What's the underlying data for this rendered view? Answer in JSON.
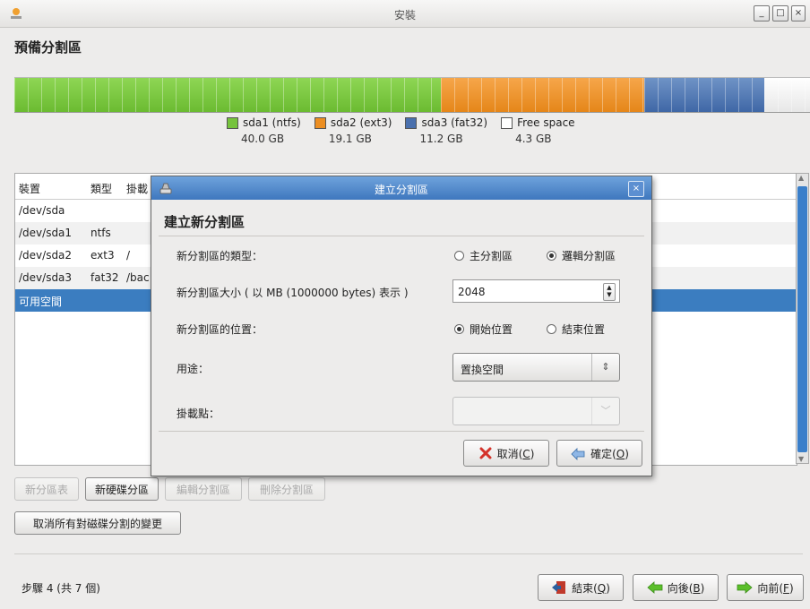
{
  "window": {
    "title": "安裝"
  },
  "page_title": "預備分割區",
  "partition_bar": {
    "segments": [
      {
        "name": "sda1 (ntfs)",
        "size": "40.0 GB",
        "type": "ntfs",
        "color": "#76c33d",
        "fraction": 0.5455
      },
      {
        "name": "sda2 (ext3)",
        "size": "19.1 GB",
        "type": "ext3",
        "color": "#ec8e22",
        "fraction": 0.2605
      },
      {
        "name": "sda3 (fat32)",
        "size": "11.2 GB",
        "type": "fat32",
        "color": "#4a70ad",
        "fraction": 0.1528
      },
      {
        "name": "Free space",
        "size": "4.3 GB",
        "type": "free",
        "color": "#ffffff",
        "fraction": 0.0587
      }
    ]
  },
  "table": {
    "headers": [
      "裝置",
      "類型",
      "掛載"
    ],
    "rows": [
      {
        "device": "/dev/sda",
        "type": "",
        "mount": ""
      },
      {
        "device": "/dev/sda1",
        "type": "ntfs",
        "mount": ""
      },
      {
        "device": "/dev/sda2",
        "type": "ext3",
        "mount": "/"
      },
      {
        "device": "/dev/sda3",
        "type": "fat32",
        "mount": "/bac"
      },
      {
        "device": "可用空間",
        "type": "",
        "mount": ""
      }
    ],
    "selected_index": 4
  },
  "buttons": {
    "new_table": "新分區表",
    "new_partition": "新硬碟分區",
    "edit_partition": "編輯分割區",
    "delete_partition": "刪除分割區",
    "undo_all": "取消所有對磁碟分割的變更"
  },
  "footer": {
    "step": "步驟 4 (共 7 個)",
    "quit": "結束(",
    "quit_key": "Q",
    "back": "向後(",
    "back_key": "B",
    "forward": "向前(",
    "forward_key": "F",
    "close_paren": ")"
  },
  "dialog": {
    "title": "建立分割區",
    "heading": "建立新分割區",
    "type_label": "新分割區的類型：",
    "type_primary": "主分割區",
    "type_logical": "邏輯分割區",
    "type_selected": "logical",
    "size_label": "新分割區大小 ( 以 MB (1000000 bytes) 表示 )",
    "size_value": "2048",
    "location_label": "新分割區的位置：",
    "location_begin": "開始位置",
    "location_end": "結束位置",
    "location_selected": "begin",
    "use_label": "用途：",
    "use_value": "置換空間",
    "mount_label": "掛載點：",
    "mount_value": "",
    "cancel": "取消(",
    "cancel_key": "C",
    "ok": "確定(",
    "ok_key": "O",
    "close_paren": ")"
  }
}
